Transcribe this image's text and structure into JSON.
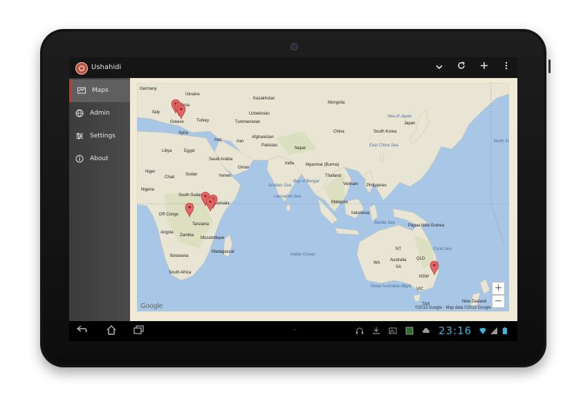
{
  "app": {
    "title": "Ushahidi"
  },
  "actionbar": {
    "dropdown_icon": "chevron-down-icon",
    "refresh_icon": "refresh-icon",
    "add_icon": "plus-icon",
    "overflow_icon": "overflow-menu-icon"
  },
  "sidebar": {
    "items": [
      {
        "label": "Maps",
        "icon": "map-icon",
        "active": true
      },
      {
        "label": "Admin",
        "icon": "globe-icon",
        "active": false
      },
      {
        "label": "Settings",
        "icon": "sliders-icon",
        "active": false
      },
      {
        "label": "About",
        "icon": "info-icon",
        "active": false
      }
    ]
  },
  "map": {
    "labels": [
      "Germany",
      "Ukraine",
      "Kazakhstan",
      "Mongolia",
      "Romania",
      "Italy",
      "Uzbekistan",
      "Greece",
      "Turkey",
      "Turkmenistan",
      "Sea of Japan",
      "Syria",
      "China",
      "South Korea",
      "Japan",
      "Libya",
      "Egypt",
      "Iraq",
      "Iran",
      "Afghanistan",
      "Pakistan",
      "Nepal",
      "East China Sea",
      "North Pacific Ocean",
      "Saudi Arabia",
      "Oman",
      "India",
      "Myanmar (Burma)",
      "Niger",
      "Chad",
      "Sudan",
      "Yemen",
      "Thailand",
      "Bay of Bengal",
      "Arabian Sea",
      "Vietnam",
      "Philippines",
      "Nigeria",
      "South Sudan",
      "Laccadive Sea",
      "Somalia",
      "Malaysia",
      "DR Congo",
      "Indonesia",
      "Banda Sea",
      "Tanzania",
      "Papua New Guinea",
      "Angola",
      "Zambia",
      "Mozambique",
      "Coral Sea",
      "Madagascar",
      "Indian Ocean",
      "NT",
      "Botswana",
      "Australia",
      "QLD",
      "South Africa",
      "WA",
      "SA",
      "NSW",
      "Great Australian Bight",
      "VIC",
      "TAS",
      "New Zealand"
    ],
    "zoom_in_label": "+",
    "zoom_out_label": "−",
    "logo": "Google",
    "copyright": "©2013 Google · Map data ©2013 Google",
    "marker_color": "#e06666"
  },
  "navbar": {
    "back_icon": "back-icon",
    "home_icon": "home-icon",
    "recents_icon": "recent-apps-icon"
  },
  "statusbar": {
    "time": "23:16",
    "icons": [
      "headset-icon",
      "download-icon",
      "image-icon",
      "app-icon",
      "cloud-icon",
      "wifi-icon",
      "signal-icon",
      "battery-icon"
    ]
  },
  "colors": {
    "accent": "#c0392b",
    "clock": "#3fb3e0",
    "water": "#a8c6e6",
    "land": "#e9e5d4"
  }
}
